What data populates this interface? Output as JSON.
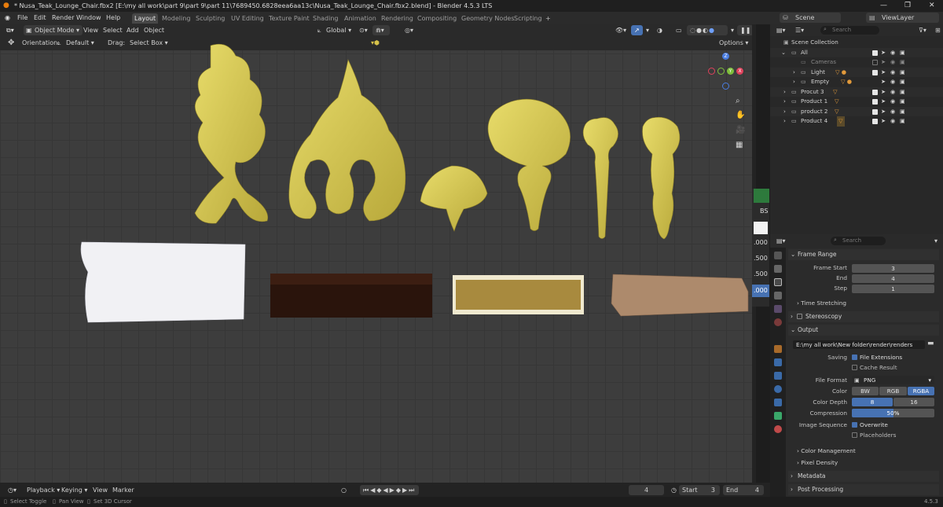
{
  "window": {
    "title": "* Nusa_Teak_Lounge_Chair.fbx2 [E:\\my all work\\part 9\\part 9\\part 11\\7689450.6828eea6aa13c\\Nusa_Teak_Lounge_Chair.fbx2.blend] - Blender 4.5.3 LTS"
  },
  "menu": [
    "File",
    "Edit",
    "Render",
    "Window",
    "Help"
  ],
  "workspaces": [
    "Layout",
    "Modeling",
    "Sculpting",
    "UV Editing",
    "Texture Paint",
    "Shading",
    "Animation",
    "Rendering",
    "Compositing",
    "Geometry Nodes",
    "Scripting"
  ],
  "scene": {
    "name": "Scene",
    "view_layer": "ViewLayer"
  },
  "viewport": {
    "mode": "Object Mode",
    "menus": [
      "View",
      "Select",
      "Add",
      "Object"
    ],
    "transform_space": "Global",
    "orientation_label": "Orientation:",
    "orientation_value": "Default",
    "drag_label": "Drag:",
    "drag_value": "Select Box",
    "options": "Options",
    "gizmo": {
      "z": "Z",
      "y": "Y",
      "x": "X"
    }
  },
  "side_labels": [
    "BS",
    ".000",
    ".500",
    ".500",
    ".000"
  ],
  "outliner": {
    "search_placeholder": "Search",
    "rows": [
      {
        "name": "Scene Collection",
        "indent": 0,
        "expanded": true,
        "checked": null
      },
      {
        "name": "All",
        "indent": 1,
        "expanded": true,
        "checked": true
      },
      {
        "name": "Cameras",
        "indent": 2,
        "expanded": false,
        "checked": false
      },
      {
        "name": "Light",
        "indent": 2,
        "expanded": false,
        "checked": true
      },
      {
        "name": "Empty",
        "indent": 2,
        "expanded": false,
        "checked": true
      },
      {
        "name": "Procut 3",
        "indent": 1,
        "expanded": false,
        "checked": true
      },
      {
        "name": "Product 1",
        "indent": 1,
        "expanded": false,
        "checked": true
      },
      {
        "name": "product 2",
        "indent": 1,
        "expanded": false,
        "checked": true
      },
      {
        "name": "Product 4",
        "indent": 1,
        "expanded": false,
        "checked": true
      }
    ]
  },
  "properties": {
    "search_placeholder": "Search",
    "frame_range": {
      "title": "Frame Range",
      "start_label": "Frame Start",
      "start": "3",
      "end_label": "End",
      "end": "4",
      "step_label": "Step",
      "step": "1"
    },
    "time_stretching": "Time Stretching",
    "stereoscopy": "Stereoscopy",
    "output": {
      "title": "Output",
      "path": "E:\\my all work\\New folder\\render\\renders",
      "saving_label": "Saving",
      "file_extensions": "File Extensions",
      "file_extensions_checked": true,
      "cache_result": "Cache Result",
      "cache_result_checked": false,
      "file_format_label": "File Format",
      "file_format": "PNG",
      "color_label": "Color",
      "color_options": [
        "BW",
        "RGB",
        "RGBA"
      ],
      "color_selected": "RGBA",
      "color_depth_label": "Color Depth",
      "color_depth_options": [
        "8",
        "16"
      ],
      "color_depth_selected": "8",
      "compression_label": "Compression",
      "compression": "50%",
      "compression_value": 0.5,
      "image_sequence_label": "Image Sequence",
      "overwrite": "Overwrite",
      "overwrite_checked": true,
      "placeholders": "Placeholders",
      "placeholders_checked": false
    },
    "color_management": "Color Management",
    "pixel_density": "Pixel Density",
    "metadata": "Metadata",
    "post_processing": "Post Processing"
  },
  "timeline": {
    "menus": [
      "Playback",
      "Keying",
      "View",
      "Marker"
    ],
    "current_frame": "4",
    "start_label": "Start",
    "start": "3",
    "end_label": "End",
    "end": "4"
  },
  "status": {
    "items": [
      "Select Toggle",
      "Pan View",
      "Set 3D Cursor"
    ],
    "version": "4.5.3"
  },
  "colors": {
    "accent": "#4772b3",
    "gold": "#d9cc53",
    "header": "#2a2a2a",
    "panel": "#303030"
  }
}
